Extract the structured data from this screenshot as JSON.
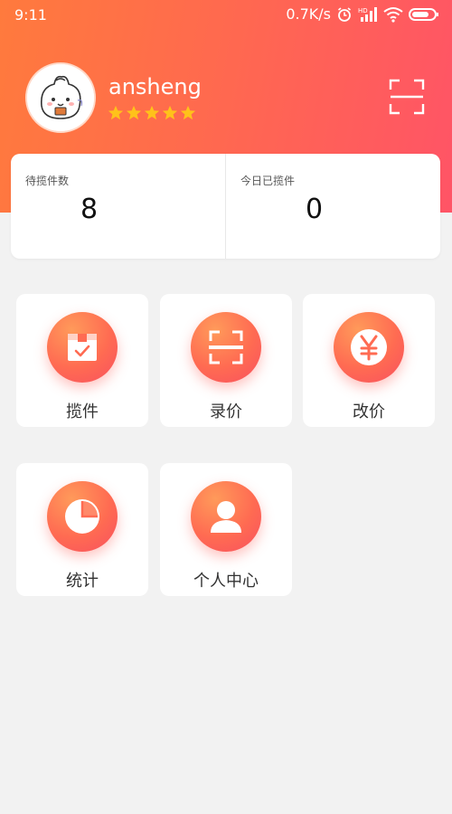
{
  "status_bar": {
    "time": "9:11",
    "speed": "0.7K/s",
    "icons": [
      "alarm-icon",
      "hd-signal-icon",
      "wifi-icon",
      "battery-icon"
    ]
  },
  "profile": {
    "username": "ansheng",
    "rating_stars": 5,
    "avatar": "bun-character-avatar"
  },
  "stats": [
    {
      "label": "待揽件数",
      "value": "8"
    },
    {
      "label": "今日已揽件",
      "value": "0"
    }
  ],
  "menu": [
    {
      "label": "揽件",
      "icon": "package-box-icon"
    },
    {
      "label": "录价",
      "icon": "scan-frame-icon"
    },
    {
      "label": "改价",
      "icon": "yen-coin-icon"
    },
    {
      "label": "统计",
      "icon": "pie-chart-icon"
    },
    {
      "label": "个人中心",
      "icon": "user-profile-icon"
    }
  ],
  "colors": {
    "header_start": "#ff7a3d",
    "header_end": "#ff5466",
    "star": "#ffc21a",
    "icon_circle": "#ff6b52"
  }
}
